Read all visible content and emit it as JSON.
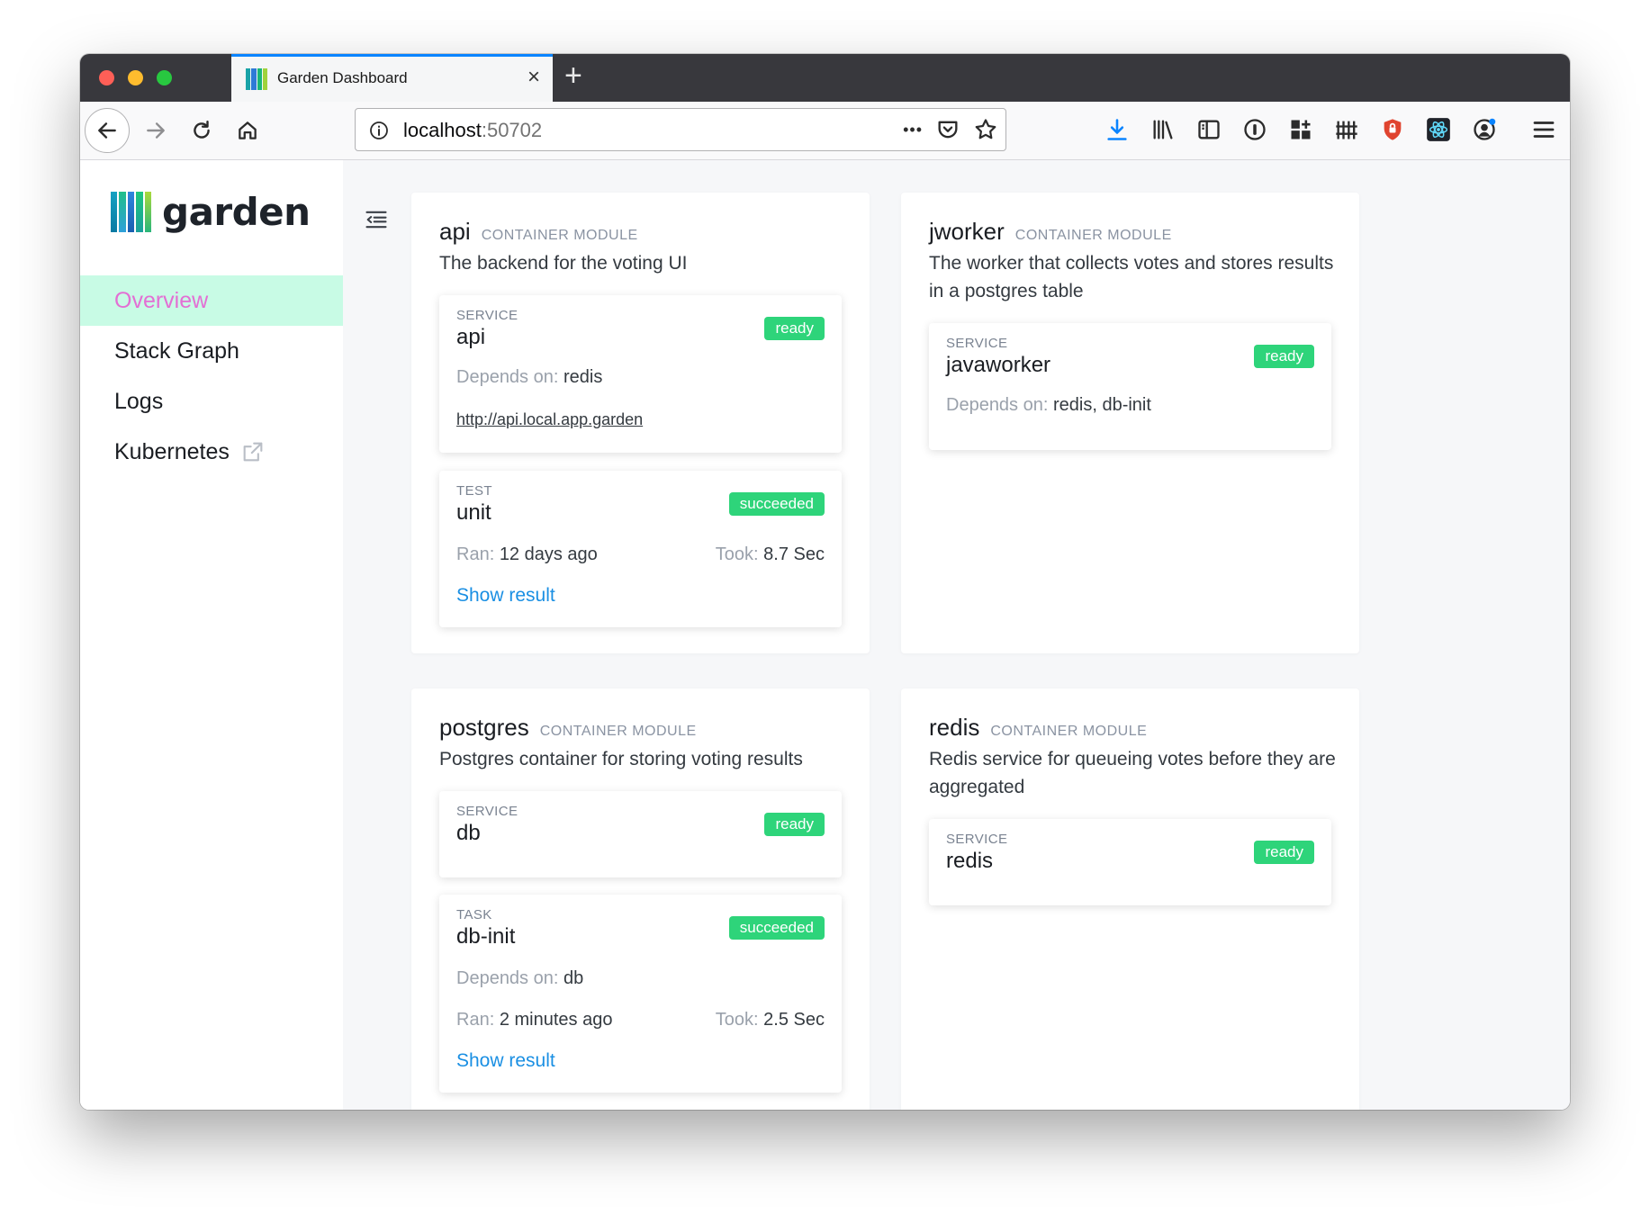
{
  "browser": {
    "tab_title": "Garden Dashboard",
    "url_host": "localhost",
    "url_port": ":50702"
  },
  "app": {
    "logo_text": "garden",
    "nav": [
      {
        "label": "Overview",
        "active": true
      },
      {
        "label": "Stack Graph",
        "active": false
      },
      {
        "label": "Logs",
        "active": false
      },
      {
        "label": "Kubernetes",
        "active": false
      }
    ]
  },
  "labels": {
    "depends_on": "Depends on:",
    "ran": "Ran:",
    "took": "Took:",
    "show_result": "Show result"
  },
  "modules": [
    {
      "name": "api",
      "type": "CONTAINER MODULE",
      "description": "The backend for the voting UI",
      "entities": [
        {
          "kind": "SERVICE",
          "name": "api",
          "status": "ready",
          "depends_on": "redis",
          "link": "http://api.local.app.garden"
        },
        {
          "kind": "TEST",
          "name": "unit",
          "status": "succeeded",
          "ran": "12 days ago",
          "took": "8.7 Sec"
        }
      ]
    },
    {
      "name": "jworker",
      "type": "CONTAINER MODULE",
      "description": "The worker that collects votes and stores results in a postgres table",
      "entities": [
        {
          "kind": "SERVICE",
          "name": "javaworker",
          "status": "ready",
          "depends_on": "redis, db-init"
        }
      ]
    },
    {
      "name": "postgres",
      "type": "CONTAINER MODULE",
      "description": "Postgres container for storing voting results",
      "entities": [
        {
          "kind": "SERVICE",
          "name": "db",
          "status": "ready"
        },
        {
          "kind": "TASK",
          "name": "db-init",
          "status": "succeeded",
          "depends_on": "db",
          "ran": "2 minutes ago",
          "took": "2.5 Sec"
        }
      ]
    },
    {
      "name": "redis",
      "type": "CONTAINER MODULE",
      "description": "Redis service for queueing votes before they are aggregated",
      "entities": [
        {
          "kind": "SERVICE",
          "name": "redis",
          "status": "ready"
        }
      ]
    }
  ],
  "colors": {
    "status_ok": "#2ed47a",
    "nav_active_bg": "#c8fbe5",
    "nav_active_text": "#e36fd4",
    "link": "#1a8fe3",
    "tab_accent": "#0a84ff"
  },
  "icons": {
    "tab_close": "×",
    "new_tab": "+",
    "url_more": "•••"
  }
}
